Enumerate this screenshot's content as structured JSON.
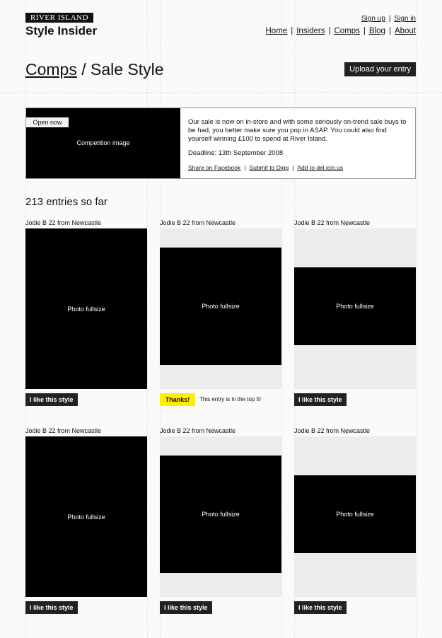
{
  "brand": {
    "logo": "RIVER ISLAND",
    "site_title": "Style Insider"
  },
  "toplinks": {
    "signup": "Sign up",
    "signin": "Sign in"
  },
  "nav": [
    "Home",
    "Insiders",
    "Comps",
    "Blog",
    "About"
  ],
  "separator": "|",
  "heading": {
    "section": "Comps",
    "slash": "/",
    "title": "Sale Style"
  },
  "upload_button": "Upload your entry",
  "competition": {
    "badge": "Open now",
    "image_label": "Competition image",
    "description": "Our sale is now on in-store and with some seriously on-trend sale buys to be had, you better make sure you pop in ASAP. You could also find yourself winning £100 to spend at River Island.",
    "deadline": "Deadline: 13th September 2008",
    "share": [
      "Share on Facebook",
      "Submit to Digg",
      "Add to del.icio.us"
    ]
  },
  "entries_count": "213 entries so far",
  "entries": [
    {
      "caption": "Jodie B 22 from Newcastle",
      "photo_label": "Photo fullsize",
      "action": "I like this style"
    },
    {
      "caption": "Jodie B 22 from Newcastle",
      "photo_label": "Photo fullsize",
      "thanks": "Thanks!",
      "note": "This entry is in the top 5!"
    },
    {
      "caption": "Jodie B 22 from Newcastle",
      "photo_label": "Photo fullsize",
      "action": "I like this style"
    },
    {
      "caption": "Jodie B 22 from Newcastle",
      "photo_label": "Photo fullsize",
      "action": "I like this style"
    },
    {
      "caption": "Jodie B 22 from Newcastle",
      "photo_label": "Photo fullsize",
      "action": "I like this style"
    },
    {
      "caption": "Jodie B 22 from Newcastle",
      "photo_label": "Photo fullsize",
      "action": "I like this style"
    }
  ],
  "colors": {
    "accent_yellow": "#ffee00",
    "button_dark": "#222222",
    "image_black": "#000000"
  }
}
